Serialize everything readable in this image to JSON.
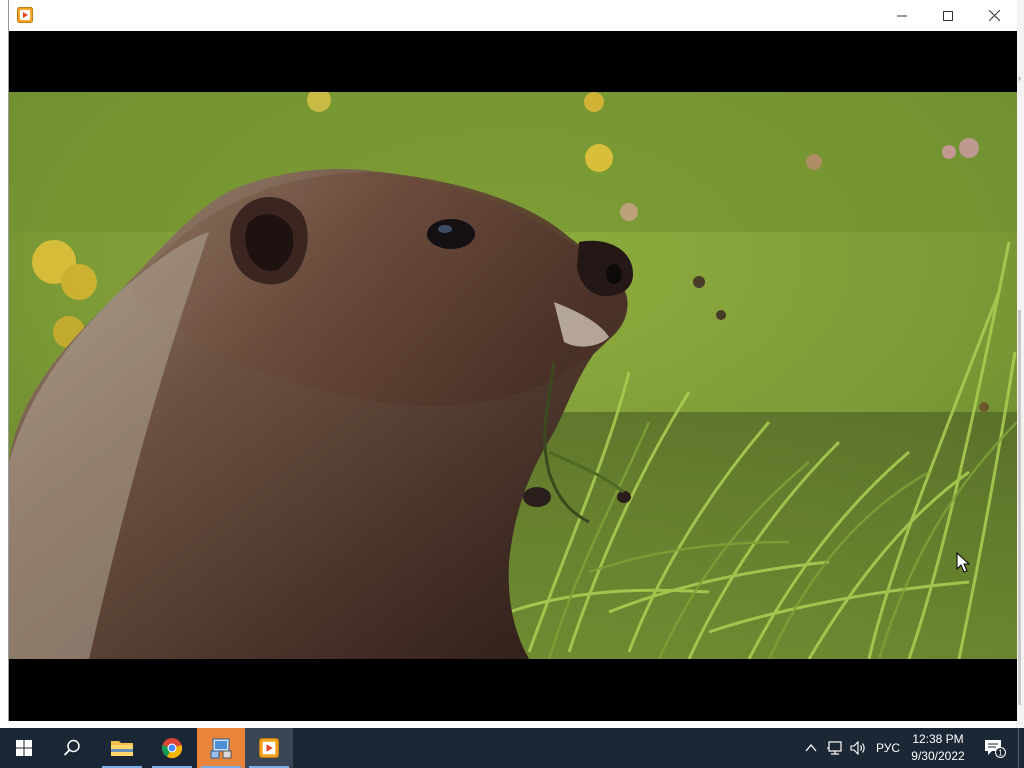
{
  "window": {
    "title": "",
    "controls": {
      "minimize": "minimize",
      "maximize": "maximize",
      "close": "close"
    }
  },
  "video": {
    "scene": "marmot-in-meadow"
  },
  "taskbar": {
    "items": [
      {
        "name": "start-button",
        "icon": "windows-logo-icon"
      },
      {
        "name": "search-button",
        "icon": "search-icon"
      },
      {
        "name": "file-explorer",
        "icon": "folder-icon"
      },
      {
        "name": "chrome",
        "icon": "chrome-icon"
      },
      {
        "name": "control-panel",
        "icon": "control-panel-icon"
      },
      {
        "name": "media-player",
        "icon": "media-player-icon"
      }
    ],
    "language": "РУС",
    "time": "12:38 PM",
    "date": "9/30/2022",
    "notification_count": "1"
  },
  "colors": {
    "taskbar": "#1c2735",
    "accent": "#7ab0e6",
    "letterbox": "#000000"
  }
}
